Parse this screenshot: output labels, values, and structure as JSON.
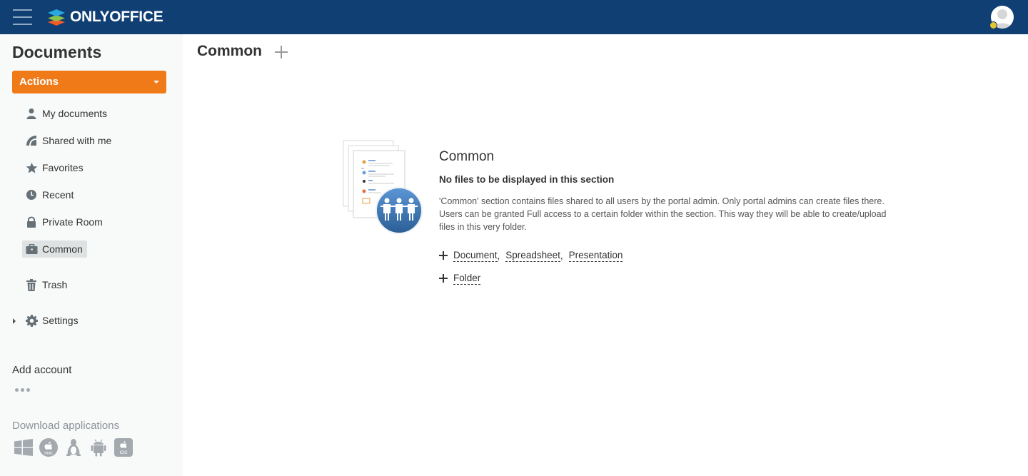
{
  "header": {
    "logo_text": "ONLYOFFICE",
    "bg_color": "#0f3f73"
  },
  "sidebar": {
    "title": "Documents",
    "actions_label": "Actions",
    "nav": {
      "my_documents": "My documents",
      "shared_with_me": "Shared with me",
      "favorites": "Favorites",
      "recent": "Recent",
      "private_room": "Private Room",
      "common": "Common",
      "trash": "Trash",
      "settings": "Settings"
    },
    "add_account": "Add account",
    "download_apps": "Download applications",
    "apps": {
      "mac_label": "mac",
      "ios_label": "iOS"
    }
  },
  "main": {
    "title": "Common",
    "empty": {
      "heading": "Common",
      "subheading": "No files to be displayed in this section",
      "description": "'Common' section contains files shared to all users by the portal admin. Only portal admins can create files there. Users can be granted Full access to a certain folder within the section. This way they will be able to create/upload files in this very folder.",
      "create_document": "Document",
      "create_spreadsheet": "Spreadsheet",
      "create_presentation": "Presentation",
      "create_folder": "Folder",
      "separator": ","
    }
  },
  "colors": {
    "accent_orange": "#f07a18",
    "sidebar_bg": "#f8f9f9",
    "active_item_bg": "#dfe2e3"
  }
}
